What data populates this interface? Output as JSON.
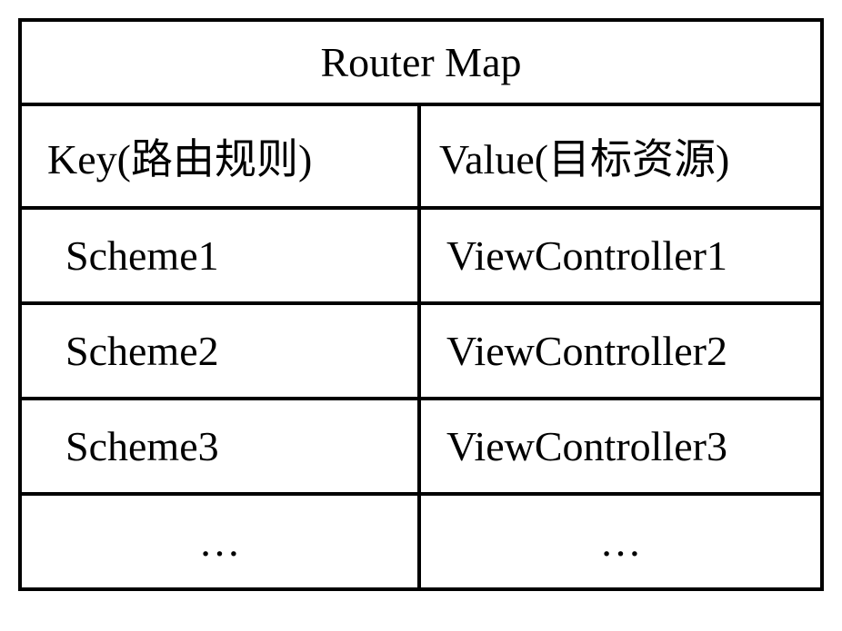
{
  "table": {
    "title": "Router Map",
    "header": {
      "key": "Key(路由规则)",
      "value": "Value(目标资源)"
    },
    "rows": [
      {
        "key": "Scheme1",
        "value": "ViewController1"
      },
      {
        "key": "Scheme2",
        "value": "ViewController2"
      },
      {
        "key": "Scheme3",
        "value": "ViewController3"
      }
    ],
    "ellipsis": "…"
  }
}
